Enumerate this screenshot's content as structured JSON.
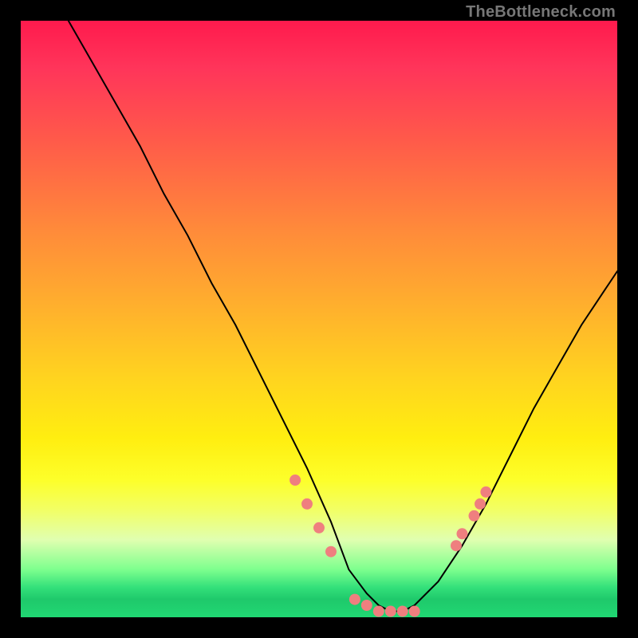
{
  "watermark": "TheBottleneck.com",
  "colors": {
    "dot": "#ef7f7f",
    "curve": "#000000"
  },
  "chart_data": {
    "type": "line",
    "title": "",
    "xlabel": "",
    "ylabel": "",
    "xlim": [
      0,
      100
    ],
    "ylim": [
      0,
      100
    ],
    "grid": false,
    "legend": false,
    "note": "No axis ticks or numeric labels are shown in the source image; x and y are normalised 0–100. Curve is a V-shaped bottleneck profile with a flat minimum near x≈55–66.",
    "series": [
      {
        "name": "bottleneck-curve",
        "x": [
          8,
          12,
          16,
          20,
          24,
          28,
          32,
          36,
          40,
          44,
          48,
          52,
          55,
          58,
          60,
          62,
          64,
          66,
          70,
          74,
          78,
          82,
          86,
          90,
          94,
          98,
          100
        ],
        "values": [
          100,
          93,
          86,
          79,
          71,
          64,
          56,
          49,
          41,
          33,
          25,
          16,
          8,
          4,
          2,
          1,
          1,
          2,
          6,
          12,
          19,
          27,
          35,
          42,
          49,
          55,
          58
        ]
      },
      {
        "name": "highlight-dots",
        "x": [
          46,
          48,
          50,
          52,
          56,
          58,
          60,
          62,
          64,
          66,
          73,
          74,
          76,
          77,
          78
        ],
        "values": [
          23,
          19,
          15,
          11,
          3,
          2,
          1,
          1,
          1,
          1,
          12,
          14,
          17,
          19,
          21
        ]
      }
    ]
  }
}
